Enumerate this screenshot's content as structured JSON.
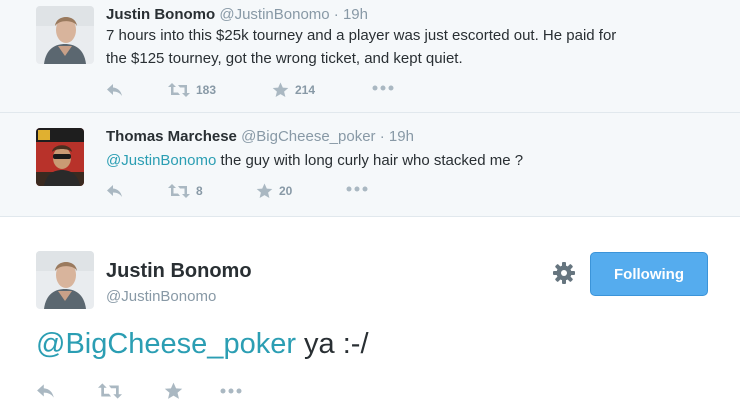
{
  "tweets": [
    {
      "name": "Justin Bonomo",
      "handle": "@JustinBonomo",
      "time": "19h",
      "separator": "·",
      "text_line1": "7 hours into this $25k tourney and a player was just escorted out. He paid for",
      "text_line2": "the $125 tourney, got the wrong ticket, and kept quiet.",
      "retweets": "183",
      "favorites": "214"
    },
    {
      "name": "Thomas Marchese",
      "handle": "@BigCheese_poker",
      "time": "19h",
      "separator": "·",
      "mention": "@JustinBonomo",
      "text": " the guy with long curly hair who stacked me ?",
      "retweets": "8",
      "favorites": "20"
    }
  ],
  "main": {
    "name": "Justin Bonomo",
    "handle": "@JustinBonomo",
    "follow_label": "Following",
    "mention": "@BigCheese_poker",
    "text": " ya :-/"
  },
  "icons": {
    "reply": "reply-icon",
    "retweet": "retweet-icon",
    "favorite": "star-icon",
    "more": "more-icon",
    "settings": "gear-icon"
  },
  "colors": {
    "link": "#2b9eb3",
    "button": "#55acee",
    "muted": "#8899a6",
    "icon": "#aab8c2"
  }
}
